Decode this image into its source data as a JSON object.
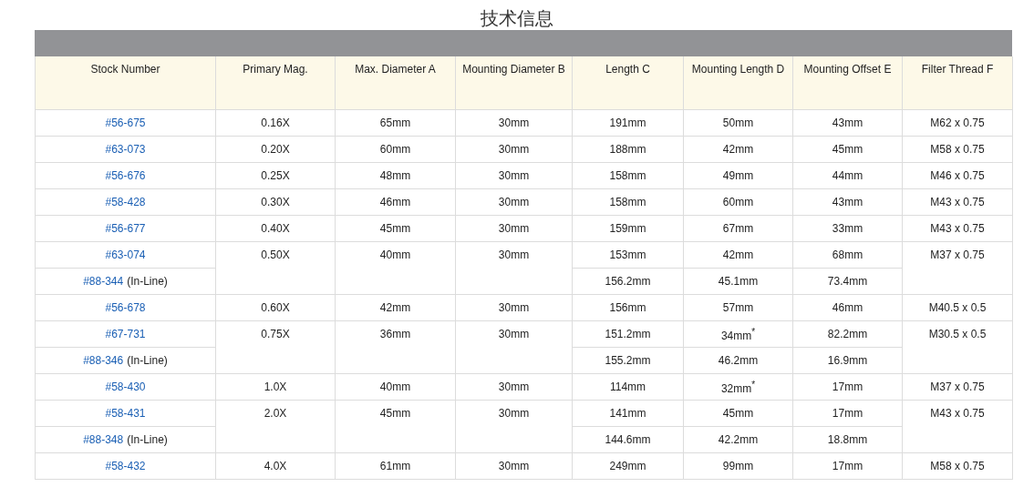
{
  "title": "技术信息",
  "columns": [
    "Stock Number",
    "Primary Mag.",
    "Max. Diameter A",
    "Mounting Diameter B",
    "Length C",
    "Mounting Length D",
    "Mounting Offset E",
    "Filter Thread F"
  ],
  "groups": [
    {
      "primary_mag": "0.16X",
      "max_diameter_a": "65mm",
      "mounting_diameter_b": "30mm",
      "filter_thread_f": "M62 x 0.75",
      "variants": [
        {
          "stock_number": "#56-675",
          "length_c": "191mm",
          "mounting_length_d": "50mm",
          "mounting_offset_e": "43mm"
        }
      ]
    },
    {
      "primary_mag": "0.20X",
      "max_diameter_a": "60mm",
      "mounting_diameter_b": "30mm",
      "filter_thread_f": "M58 x 0.75",
      "variants": [
        {
          "stock_number": "#63-073",
          "length_c": "188mm",
          "mounting_length_d": "42mm",
          "mounting_offset_e": "45mm"
        }
      ]
    },
    {
      "primary_mag": "0.25X",
      "max_diameter_a": "48mm",
      "mounting_diameter_b": "30mm",
      "filter_thread_f": "M46 x 0.75",
      "variants": [
        {
          "stock_number": "#56-676",
          "length_c": "158mm",
          "mounting_length_d": "49mm",
          "mounting_offset_e": "44mm"
        }
      ]
    },
    {
      "primary_mag": "0.30X",
      "max_diameter_a": "46mm",
      "mounting_diameter_b": "30mm",
      "filter_thread_f": "M43 x 0.75",
      "variants": [
        {
          "stock_number": "#58-428",
          "length_c": "158mm",
          "mounting_length_d": "60mm",
          "mounting_offset_e": "43mm"
        }
      ]
    },
    {
      "primary_mag": "0.40X",
      "max_diameter_a": "45mm",
      "mounting_diameter_b": "30mm",
      "filter_thread_f": "M43 x 0.75",
      "variants": [
        {
          "stock_number": "#56-677",
          "length_c": "159mm",
          "mounting_length_d": "67mm",
          "mounting_offset_e": "33mm"
        }
      ]
    },
    {
      "primary_mag": "0.50X",
      "max_diameter_a": "40mm",
      "mounting_diameter_b": "30mm",
      "filter_thread_f": "M37 x 0.75",
      "variants": [
        {
          "stock_number": "#63-074",
          "length_c": "153mm",
          "mounting_length_d": "42mm",
          "mounting_offset_e": "68mm"
        },
        {
          "stock_number": "#88-344",
          "note": "(In-Line)",
          "length_c": "156.2mm",
          "mounting_length_d": "45.1mm",
          "mounting_offset_e": "73.4mm"
        }
      ]
    },
    {
      "primary_mag": "0.60X",
      "max_diameter_a": "42mm",
      "mounting_diameter_b": "30mm",
      "filter_thread_f": "M40.5 x 0.5",
      "variants": [
        {
          "stock_number": "#56-678",
          "length_c": "156mm",
          "mounting_length_d": "57mm",
          "mounting_offset_e": "46mm"
        }
      ]
    },
    {
      "primary_mag": "0.75X",
      "max_diameter_a": "36mm",
      "mounting_diameter_b": "30mm",
      "filter_thread_f": "M30.5 x 0.5",
      "variants": [
        {
          "stock_number": "#67-731",
          "length_c": "151.2mm",
          "mounting_length_d": "34mm$^{*}$",
          "mounting_offset_e": "82.2mm"
        },
        {
          "stock_number": "#88-346",
          "note": "(In-Line)",
          "length_c": "155.2mm",
          "mounting_length_d": "46.2mm",
          "mounting_offset_e": "16.9mm"
        }
      ]
    },
    {
      "primary_mag": "1.0X",
      "max_diameter_a": "40mm",
      "mounting_diameter_b": "30mm",
      "filter_thread_f": "M37 x 0.75",
      "variants": [
        {
          "stock_number": "#58-430",
          "length_c": "114mm",
          "mounting_length_d": "32mm$^{*}$",
          "mounting_offset_e": "17mm"
        }
      ]
    },
    {
      "primary_mag": "2.0X",
      "max_diameter_a": "45mm",
      "mounting_diameter_b": "30mm",
      "filter_thread_f": "M43 x 0.75",
      "variants": [
        {
          "stock_number": "#58-431",
          "length_c": "141mm",
          "mounting_length_d": "45mm",
          "mounting_offset_e": "17mm"
        },
        {
          "stock_number": "#88-348",
          "note": "(In-Line)",
          "length_c": "144.6mm",
          "mounting_length_d": "42.2mm",
          "mounting_offset_e": "18.8mm"
        }
      ]
    },
    {
      "primary_mag": "4.0X",
      "max_diameter_a": "61mm",
      "mounting_diameter_b": "30mm",
      "filter_thread_f": "M58 x 0.75",
      "variants": [
        {
          "stock_number": "#58-432",
          "length_c": "249mm",
          "mounting_length_d": "99mm",
          "mounting_offset_e": "17mm"
        }
      ]
    }
  ]
}
